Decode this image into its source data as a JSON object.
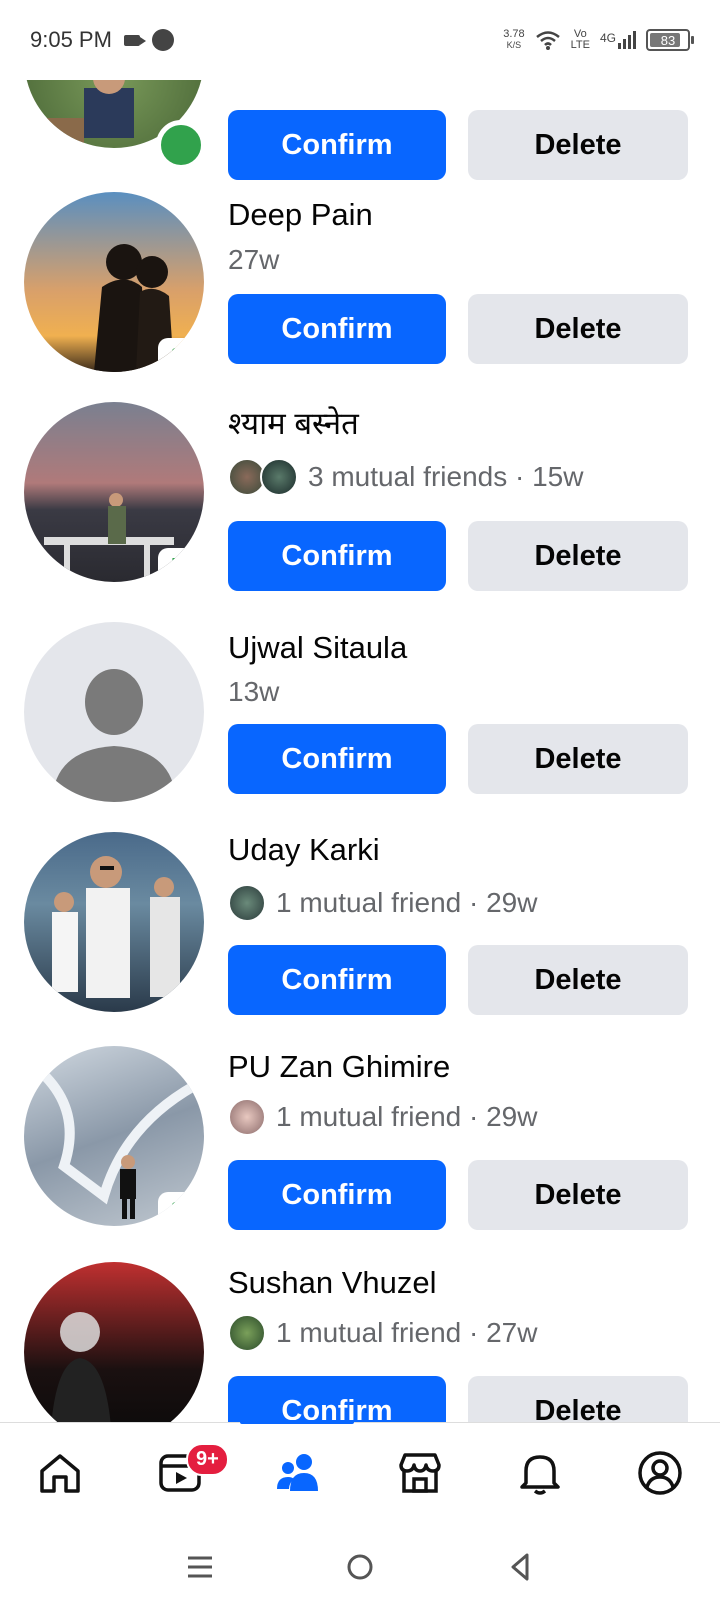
{
  "status_bar": {
    "time": "9:05 PM",
    "net_speed_value": "3.78",
    "net_speed_unit": "K/S",
    "volte_top": "Vo",
    "volte_bottom": "LTE",
    "network": "4G",
    "battery": "83"
  },
  "requests": [
    {
      "name": "",
      "meta": "",
      "confirm_label": "Confirm",
      "delete_label": "Delete",
      "avatar_time": "",
      "online": true,
      "avatar_color": "#5d7a4a"
    },
    {
      "name": "Deep Pain",
      "meta": "27w",
      "confirm_label": "Confirm",
      "delete_label": "Delete",
      "avatar_time": "3h",
      "avatar_color": "#c98a4a"
    },
    {
      "name": "श्याम बस्नेत",
      "meta": "3 mutual friends · 15w",
      "confirm_label": "Confirm",
      "delete_label": "Delete",
      "avatar_time": "5h",
      "avatar_color": "#6b6b7a"
    },
    {
      "name": "Ujwal Sitaula",
      "meta": "13w",
      "confirm_label": "Confirm",
      "delete_label": "Delete",
      "avatar_time": "",
      "avatar_color": "#dcdcdc"
    },
    {
      "name": "Uday Karki",
      "meta": "1 mutual friend · 29w",
      "confirm_label": "Confirm",
      "delete_label": "Delete",
      "avatar_time": "",
      "avatar_color": "#4a6a8a"
    },
    {
      "name": "PU Zan Ghimire",
      "meta": "1 mutual friend · 29w",
      "confirm_label": "Confirm",
      "delete_label": "Delete",
      "avatar_time": "3h",
      "avatar_color": "#9aa5b0"
    },
    {
      "name": "Sushan Vhuzel",
      "meta": "1 mutual friend · 27w",
      "confirm_label": "Confirm",
      "delete_label": "Delete",
      "avatar_time": "",
      "avatar_color": "#2a1a1a"
    }
  ],
  "bottom_nav": {
    "video_badge": "9+",
    "active_tab": "friends",
    "accent_color": "#0866ff"
  },
  "colors": {
    "confirm": "#0866ff",
    "delete": "#e4e6eb",
    "online": "#31a24c",
    "badge": "#e41e3f"
  }
}
